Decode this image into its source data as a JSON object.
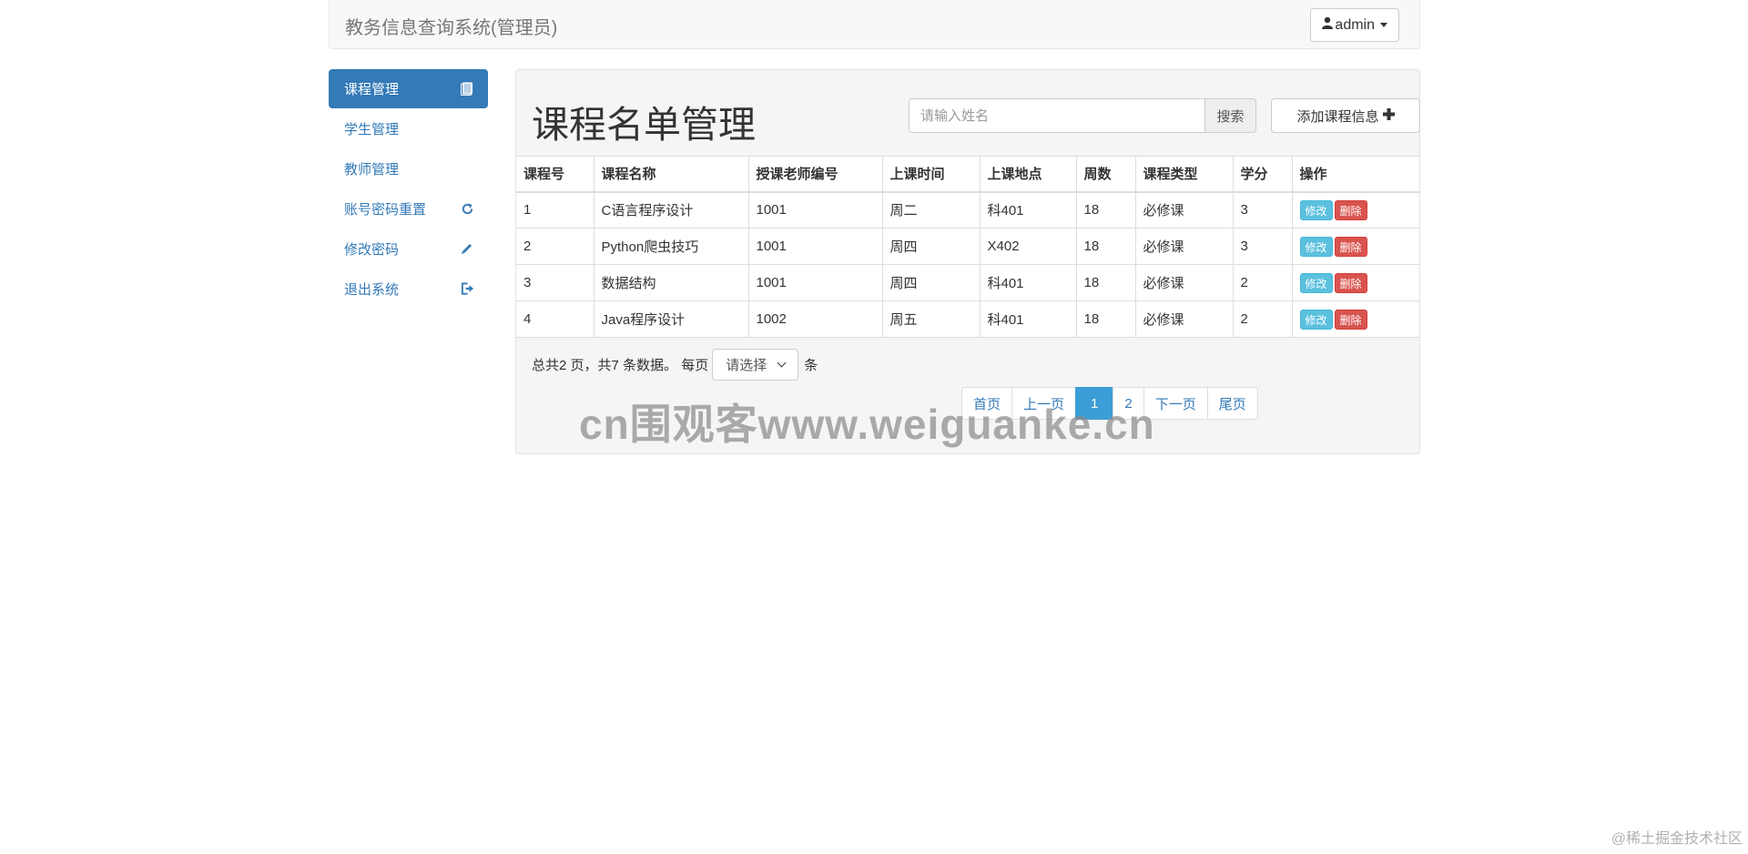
{
  "navbar": {
    "brand": "教务信息查询系统(管理员)",
    "user_label": "admin",
    "icons": {
      "user": "user-icon",
      "caret": "caret-down-icon"
    }
  },
  "sidebar": {
    "items": [
      {
        "label": "课程管理",
        "icon": "book-icon",
        "active": true
      },
      {
        "label": "学生管理",
        "icon": "",
        "active": false
      },
      {
        "label": "教师管理",
        "icon": "",
        "active": false
      },
      {
        "label": "账号密码重置",
        "icon": "refresh-icon",
        "active": false
      },
      {
        "label": "修改密码",
        "icon": "pencil-icon",
        "active": false
      },
      {
        "label": "退出系统",
        "icon": "logout-icon",
        "active": false
      }
    ]
  },
  "main": {
    "title": "课程名单管理",
    "search": {
      "placeholder": "请输入姓名",
      "value": "",
      "button": "搜索"
    },
    "add_button": "添加课程信息",
    "table": {
      "headers": [
        "课程号",
        "课程名称",
        "授课老师编号",
        "上课时间",
        "上课地点",
        "周数",
        "课程类型",
        "学分",
        "操作"
      ],
      "rows": [
        [
          "1",
          "C语言程序设计",
          "1001",
          "周二",
          "科401",
          "18",
          "必修课",
          "3"
        ],
        [
          "2",
          "Python爬虫技巧",
          "1001",
          "周四",
          "X402",
          "18",
          "必修课",
          "3"
        ],
        [
          "3",
          "数据结构",
          "1001",
          "周四",
          "科401",
          "18",
          "必修课",
          "2"
        ],
        [
          "4",
          "Java程序设计",
          "1002",
          "周五",
          "科401",
          "18",
          "必修课",
          "2"
        ]
      ],
      "edit_label": "修改",
      "delete_label": "删除"
    },
    "pager_info": {
      "summary": "总共2 页，共7 条数据。 每页",
      "select_value": "请选择",
      "suffix": "条"
    },
    "pagination": {
      "first": "首页",
      "prev": "上一页",
      "pages": [
        "1",
        "2"
      ],
      "current": "1",
      "next": "下一页",
      "last": "尾页"
    }
  },
  "watermarks": {
    "center": "cn围观客www.weiguanke.cn",
    "corner": "@稀土掘金技术社区"
  },
  "colors": {
    "primary": "#337ab7",
    "info": "#5bc0de",
    "danger": "#d9534f",
    "active_page": "#3c9ed6"
  }
}
